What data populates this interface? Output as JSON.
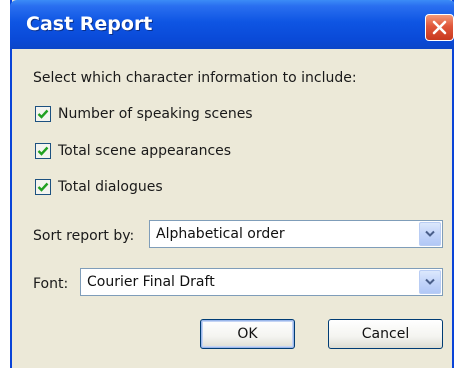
{
  "window": {
    "title": "Cast Report"
  },
  "instructions": "Select which character information to include:",
  "options": [
    {
      "label": "Number of speaking scenes",
      "checked": true
    },
    {
      "label": "Total scene appearances",
      "checked": true
    },
    {
      "label": "Total dialogues",
      "checked": true
    }
  ],
  "sort": {
    "label": "Sort report by:",
    "value": "Alphabetical order"
  },
  "font": {
    "label": "Font:",
    "value": "Courier Final Draft"
  },
  "buttons": {
    "ok": "OK",
    "cancel": "Cancel"
  },
  "colors": {
    "titlebar": "#0a4ad8",
    "dialog_bg": "#ece9d8",
    "close": "#e0563a",
    "check": "#21a121"
  },
  "icons": {
    "close": "close-icon",
    "check": "checkmark-icon",
    "dropdown": "chevron-down-icon"
  }
}
